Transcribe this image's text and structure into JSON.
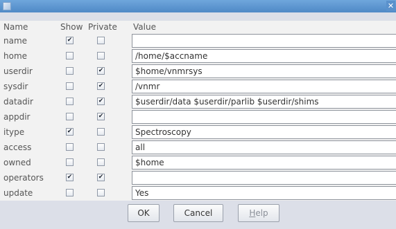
{
  "header": {
    "name": "Name",
    "show": "Show",
    "private": "Private",
    "value": "Value"
  },
  "rows": [
    {
      "name": "name",
      "show": true,
      "private": false,
      "value": ""
    },
    {
      "name": "home",
      "show": false,
      "private": false,
      "value": "/home/$accname"
    },
    {
      "name": "userdir",
      "show": false,
      "private": true,
      "value": "$home/vnmrsys"
    },
    {
      "name": "sysdir",
      "show": false,
      "private": true,
      "value": "/vnmr"
    },
    {
      "name": "datadir",
      "show": false,
      "private": true,
      "value": "$userdir/data $userdir/parlib $userdir/shims"
    },
    {
      "name": "appdir",
      "show": false,
      "private": true,
      "value": ""
    },
    {
      "name": "itype",
      "show": true,
      "private": false,
      "value": "Spectroscopy"
    },
    {
      "name": "access",
      "show": false,
      "private": false,
      "value": "all"
    },
    {
      "name": "owned",
      "show": false,
      "private": false,
      "value": "$home"
    },
    {
      "name": "operators",
      "show": true,
      "private": true,
      "value": ""
    },
    {
      "name": "update",
      "show": false,
      "private": false,
      "value": "Yes"
    }
  ],
  "buttons": {
    "ok": "OK",
    "cancel": "Cancel",
    "help_mnemonic": "H",
    "help_rest": "elp"
  },
  "icons": {
    "close": "close-icon",
    "app": "app-icon",
    "check": "✔"
  }
}
